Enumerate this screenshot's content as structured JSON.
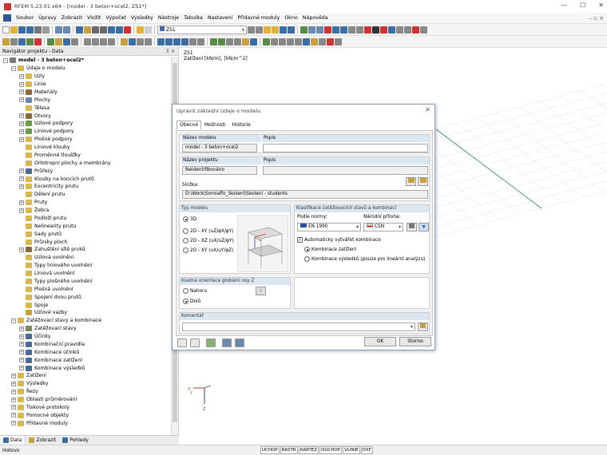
{
  "window": {
    "title": "RFEM 5.23.01 x64 - [model - 3 beton+ocel2, ZS1*]",
    "controls": [
      "—",
      "☐",
      "✕"
    ]
  },
  "menu": {
    "items": [
      "Soubor",
      "Úpravy",
      "Zobrazit",
      "Vložit",
      "Výpočet",
      "Výsledky",
      "Nástroje",
      "Tabulka",
      "Nastavení",
      "Přídavné moduly",
      "Okno",
      "Nápověda"
    ],
    "mdi_controls": "– ▫ ×"
  },
  "toolbar": {
    "loadcase_combo": "ZS1"
  },
  "navigator": {
    "title": "Navigátor projektu - Data",
    "pin": "⊼ ✕",
    "tree": [
      {
        "label": "model - 3 beton+ocel2*",
        "level": 0,
        "exp": "−",
        "color": "#7a7a7a",
        "bold": true
      },
      {
        "label": "Údaje o modelu",
        "level": 1,
        "exp": "−",
        "color": "#d9b650"
      },
      {
        "label": "Uzly",
        "level": 2,
        "exp": "+",
        "color": "#d9b650"
      },
      {
        "label": "Linie",
        "level": 2,
        "exp": "+",
        "color": "#d9b650"
      },
      {
        "label": "Materiály",
        "level": 2,
        "exp": "+",
        "color": "#8a6a3a"
      },
      {
        "label": "Plochy",
        "level": 2,
        "exp": "+",
        "color": "#6a8ab0"
      },
      {
        "label": "Tělesa",
        "level": 2,
        "exp": "",
        "color": "#d9b650"
      },
      {
        "label": "Otvory",
        "level": 2,
        "exp": "+",
        "color": "#8a6a3a"
      },
      {
        "label": "Uzlové podpory",
        "level": 2,
        "exp": "+",
        "color": "#6a9a4a"
      },
      {
        "label": "Liniové podpory",
        "level": 2,
        "exp": "+",
        "color": "#6a9a4a"
      },
      {
        "label": "Plošné podpory",
        "level": 2,
        "exp": "+",
        "color": "#d9b650"
      },
      {
        "label": "Liniové klouby",
        "level": 2,
        "exp": "",
        "color": "#d9b650"
      },
      {
        "label": "Proměnné tloušťky",
        "level": 2,
        "exp": "",
        "color": "#d9b650"
      },
      {
        "label": "Ortotropní plochy a membrány",
        "level": 2,
        "exp": "",
        "color": "#d9b650"
      },
      {
        "label": "Průřezy",
        "level": 2,
        "exp": "+",
        "color": "#4a6a9a"
      },
      {
        "label": "Klouby na koncích prutů",
        "level": 2,
        "exp": "+",
        "color": "#d9b650"
      },
      {
        "label": "Excentricity prutu",
        "level": 2,
        "exp": "+",
        "color": "#d9b650"
      },
      {
        "label": "Dělení prutu",
        "level": 2,
        "exp": "",
        "color": "#d9b650"
      },
      {
        "label": "Pruty",
        "level": 2,
        "exp": "+",
        "color": "#d9b650"
      },
      {
        "label": "Žebra",
        "level": 2,
        "exp": "+",
        "color": "#d9b650"
      },
      {
        "label": "Podloží prutu",
        "level": 2,
        "exp": "",
        "color": "#d9b650"
      },
      {
        "label": "Nelinearity prutu",
        "level": 2,
        "exp": "",
        "color": "#d9b650"
      },
      {
        "label": "Sady prutů",
        "level": 2,
        "exp": "",
        "color": "#d9b650"
      },
      {
        "label": "Průniky ploch",
        "level": 2,
        "exp": "",
        "color": "#d9b650"
      },
      {
        "label": "Zahuštění sítě prvků",
        "level": 2,
        "exp": "+",
        "color": "#8a6a3a"
      },
      {
        "label": "Uzlová uvolnění",
        "level": 2,
        "exp": "",
        "color": "#d9b650"
      },
      {
        "label": "Typy liniového uvolnění",
        "level": 2,
        "exp": "",
        "color": "#d9b650"
      },
      {
        "label": "Liniová uvolnění",
        "level": 2,
        "exp": "",
        "color": "#d9b650"
      },
      {
        "label": "Typy plošného uvolnění",
        "level": 2,
        "exp": "",
        "color": "#d9b650"
      },
      {
        "label": "Plošná uvolnění",
        "level": 2,
        "exp": "",
        "color": "#d9b650"
      },
      {
        "label": "Spojení dvou prutů",
        "level": 2,
        "exp": "",
        "color": "#d9b650"
      },
      {
        "label": "Spoje",
        "level": 2,
        "exp": "",
        "color": "#d9b650"
      },
      {
        "label": "Uzlové vazby",
        "level": 2,
        "exp": "",
        "color": "#c8a040"
      },
      {
        "label": "Zatěžovací stavy a kombinace",
        "level": 1,
        "exp": "−",
        "color": "#d9b650"
      },
      {
        "label": "Zatěžovací stavy",
        "level": 2,
        "exp": "+",
        "color": "#7a8a5a"
      },
      {
        "label": "Účinky",
        "level": 2,
        "exp": "+",
        "color": "#4a6a9a"
      },
      {
        "label": "Kombinační pravidla",
        "level": 2,
        "exp": "+",
        "color": "#4a6a9a"
      },
      {
        "label": "Kombinace účinků",
        "level": 2,
        "exp": "+",
        "color": "#4a6a9a"
      },
      {
        "label": "Kombinace zatížení",
        "level": 2,
        "exp": "+",
        "color": "#4a6a9a"
      },
      {
        "label": "Kombinace výsledků",
        "level": 2,
        "exp": "+",
        "color": "#4a6a9a"
      },
      {
        "label": "Zatížení",
        "level": 1,
        "exp": "+",
        "color": "#d9b650"
      },
      {
        "label": "Výsledky",
        "level": 1,
        "exp": "+",
        "color": "#d9b650"
      },
      {
        "label": "Řezy",
        "level": 1,
        "exp": "+",
        "color": "#d9b650"
      },
      {
        "label": "Oblasti průměrování",
        "level": 1,
        "exp": "+",
        "color": "#d9b650"
      },
      {
        "label": "Tiskové protokoly",
        "level": 1,
        "exp": "+",
        "color": "#d9b650"
      },
      {
        "label": "Pomocné objekty",
        "level": 1,
        "exp": "+",
        "color": "#d9b650"
      },
      {
        "label": "Přídavné moduly",
        "level": 1,
        "exp": "+",
        "color": "#d9b650"
      }
    ],
    "tabs": [
      "Data",
      "Zobrazit",
      "Pohledy"
    ]
  },
  "viewport": {
    "line1": "ZS1",
    "line2": "Zatížení [kN/m], [kN/m^2]",
    "axis_x": "X",
    "axis_y": "Y",
    "axis_z": "Z"
  },
  "dialog": {
    "title": "Upravit základní údaje o modelu",
    "close": "✕",
    "tabs": [
      "Obecné",
      "Možnosti",
      "Historie"
    ],
    "model_name_label": "Název modelu",
    "model_name": "model - 3 beton+ocel2",
    "desc_label": "Popis",
    "project_name_label": "Název projektu",
    "project_name": "Neidentifikováno",
    "project_desc_label": "Popis",
    "folder_label": "Složka:",
    "folder": "D:\\Work\\Somiaffo_Školení\\Školení - students",
    "model_type_label": "Typ modelu",
    "model_types": [
      "3D",
      "2D - XY (uZ/φX/φY)",
      "2D - XZ (uX/uZ/φY)",
      "2D - XY (uX/uY/φZ)"
    ],
    "classification_label": "Klasifikace zatěžovacích stavů a kombinací",
    "standard_label": "Podle normy:",
    "standard_value": "EN 1990",
    "annex_label": "Národní příloha:",
    "annex_value": "ČSN",
    "auto_comb_label": "Automaticky vytvářet kombinace",
    "comb_options": [
      "Kombinace zatížení",
      "Kombinace výsledků (pouze pro lineární analýzu)"
    ],
    "orientation_label": "Kladná orientace globální osy Z",
    "orientations": [
      "Nahoru",
      "Dolů"
    ],
    "comment_label": "Komentář",
    "ok": "OK",
    "cancel": "Storno"
  },
  "status": {
    "text": "Hotovo",
    "buttons": [
      "UCHOP",
      "RASTR",
      "KARTEZ",
      "OUCHOP",
      "VLINIE",
      "DXF"
    ]
  }
}
